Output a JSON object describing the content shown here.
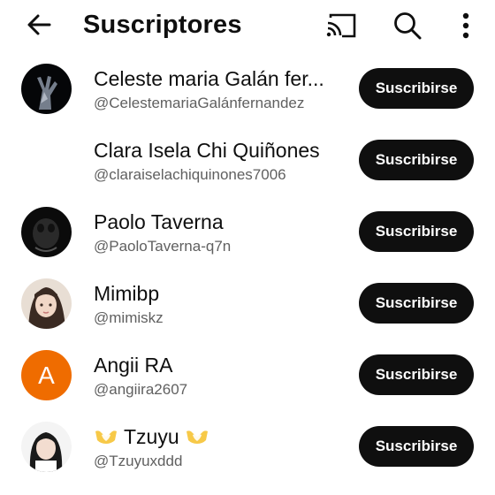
{
  "header": {
    "title": "Suscriptores",
    "back_icon": "arrow-left-icon",
    "cast_icon": "cast-icon",
    "search_icon": "search-icon",
    "more_icon": "more-vert-icon"
  },
  "colors": {
    "button_bg": "#0f0f0f",
    "button_text": "#ffffff",
    "handle_text": "#606060",
    "letter_avatar_bg": "#ef6c00",
    "emoji_yellow": "#f7c948"
  },
  "subscribers": [
    {
      "name": "Celeste maria Galán fer...",
      "handle": "@CelestemariaGalánfernandez",
      "button": "Suscribirse"
    },
    {
      "name": "Clara Isela Chi Quiñones",
      "handle": "@claraiselachiquinones7006",
      "button": "Suscribirse"
    },
    {
      "name": "Paolo Taverna",
      "handle": "@PaoloTaverna-q7n",
      "button": "Suscribirse"
    },
    {
      "name": "Mimibp",
      "handle": "@mimiskz",
      "button": "Suscribirse"
    },
    {
      "name": "Angii RA",
      "handle": "@angiira2607",
      "button": "Suscribirse",
      "avatar_letter": "A"
    },
    {
      "name_prefix_icon": "heart-hands-icon",
      "name": "Tzuyu",
      "name_suffix_icon": "heart-hands-icon",
      "handle": "@Tzuyuxddd",
      "button": "Suscribirse"
    }
  ]
}
